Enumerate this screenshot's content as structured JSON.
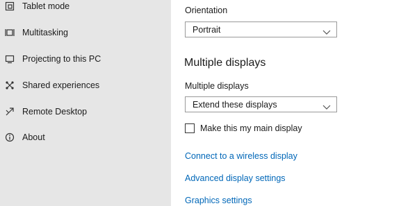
{
  "sidebar": {
    "items": [
      {
        "label": "Tablet mode",
        "icon": "tablet-mode-icon"
      },
      {
        "label": "Multitasking",
        "icon": "multitasking-icon"
      },
      {
        "label": "Projecting to this PC",
        "icon": "projecting-icon"
      },
      {
        "label": "Shared experiences",
        "icon": "shared-experiences-icon"
      },
      {
        "label": "Remote Desktop",
        "icon": "remote-desktop-icon"
      },
      {
        "label": "About",
        "icon": "info-icon"
      }
    ]
  },
  "main": {
    "orientation": {
      "label": "Orientation",
      "value": "Portrait"
    },
    "section_title": "Multiple displays",
    "multiple_displays": {
      "label": "Multiple displays",
      "value": "Extend these displays"
    },
    "main_display_checkbox": {
      "label": "Make this my main display",
      "checked": false
    },
    "links": {
      "wireless": "Connect to a wireless display",
      "advanced": "Advanced display settings",
      "graphics": "Graphics settings"
    }
  },
  "colors": {
    "sidebar_bg": "#e6e6e6",
    "link": "#0067b8",
    "text": "#1a1a1a"
  }
}
